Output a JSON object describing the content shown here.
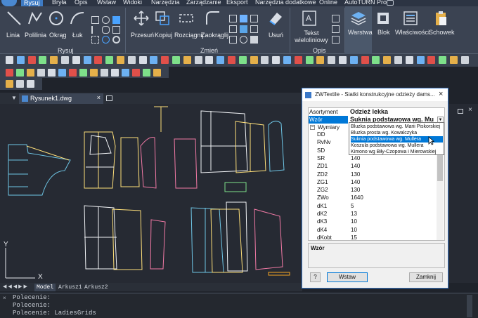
{
  "menu": [
    "Rysuj",
    "Bryła",
    "Opis",
    "Wstaw",
    "Widoki",
    "Narzędzia",
    "Zarządzanie",
    "Eksport",
    "Narzędzia dodatkowe",
    "Online",
    "AutoTURN Pro"
  ],
  "ribbon": {
    "draw_tools": [
      "Linia",
      "Polilinia",
      "Okrąg",
      "Łuk"
    ],
    "modify_tools": [
      "Przesuń",
      "Kopiuj",
      "Rozciągnij",
      "Zaokrąglij",
      "Usuń"
    ],
    "annot_tool": "Tekst wieloliniowy",
    "annot_tool_l1": "Tekst",
    "annot_tool_l2": "wieloliniowy",
    "right_tools": [
      "Warstwa",
      "Blok",
      "Właściwości",
      "Schowek"
    ],
    "groups": [
      "Rysuj",
      "Zmień",
      "Opis"
    ]
  },
  "document": {
    "tab": "Rysunek1.dwg"
  },
  "layout_tabs": [
    "Model",
    "Arkusz1",
    "Arkusz2"
  ],
  "command_lines": [
    "Polecenie:",
    "Polecenie:",
    "Polecenie: LadiesGrids"
  ],
  "axis": {
    "y": "Y",
    "x": "X"
  },
  "dialog": {
    "title": "ZWTextile - Siatki konstrukcyjne odzieży dams...",
    "assortment_label": "Asortyment",
    "assortment_value": "Odzież lekka",
    "pattern_label": "Wzór",
    "pattern_value": "Suknia podstawowa wg. Mullera",
    "dims_header": "Wymiary",
    "dropdown": [
      "Bluzka podstawowa wg. Marii Piskorskiej",
      "Bluzka prosta wg. Kowalczyka",
      "Suknia podstawowa wg. Mullera",
      "Koszula podstawowa wg. Mullera",
      "Kimono wg Biły-Czopowa i Mierowskiej"
    ],
    "dims": [
      {
        "k": "DD",
        "v": ""
      },
      {
        "k": "RvNv",
        "v": ""
      },
      {
        "k": "SD",
        "v": ""
      },
      {
        "k": "SR",
        "v": "140"
      },
      {
        "k": "ZD1",
        "v": "140"
      },
      {
        "k": "ZD2",
        "v": "130"
      },
      {
        "k": "ZG1",
        "v": "140"
      },
      {
        "k": "ZG2",
        "v": "130"
      },
      {
        "k": "ZWo",
        "v": "1640"
      },
      {
        "k": "dK1",
        "v": "5"
      },
      {
        "k": "dK2",
        "v": "13"
      },
      {
        "k": "dK3",
        "v": "10"
      },
      {
        "k": "dK4",
        "v": "10"
      },
      {
        "k": "dKobt",
        "v": "15"
      }
    ],
    "desc_label": "Wzór",
    "help": "?",
    "insert": "Wstaw",
    "close": "Zamknij"
  },
  "colors": {
    "accent": "#3e7bc4",
    "canvas": "#262a33",
    "selection": "#0078d7"
  }
}
